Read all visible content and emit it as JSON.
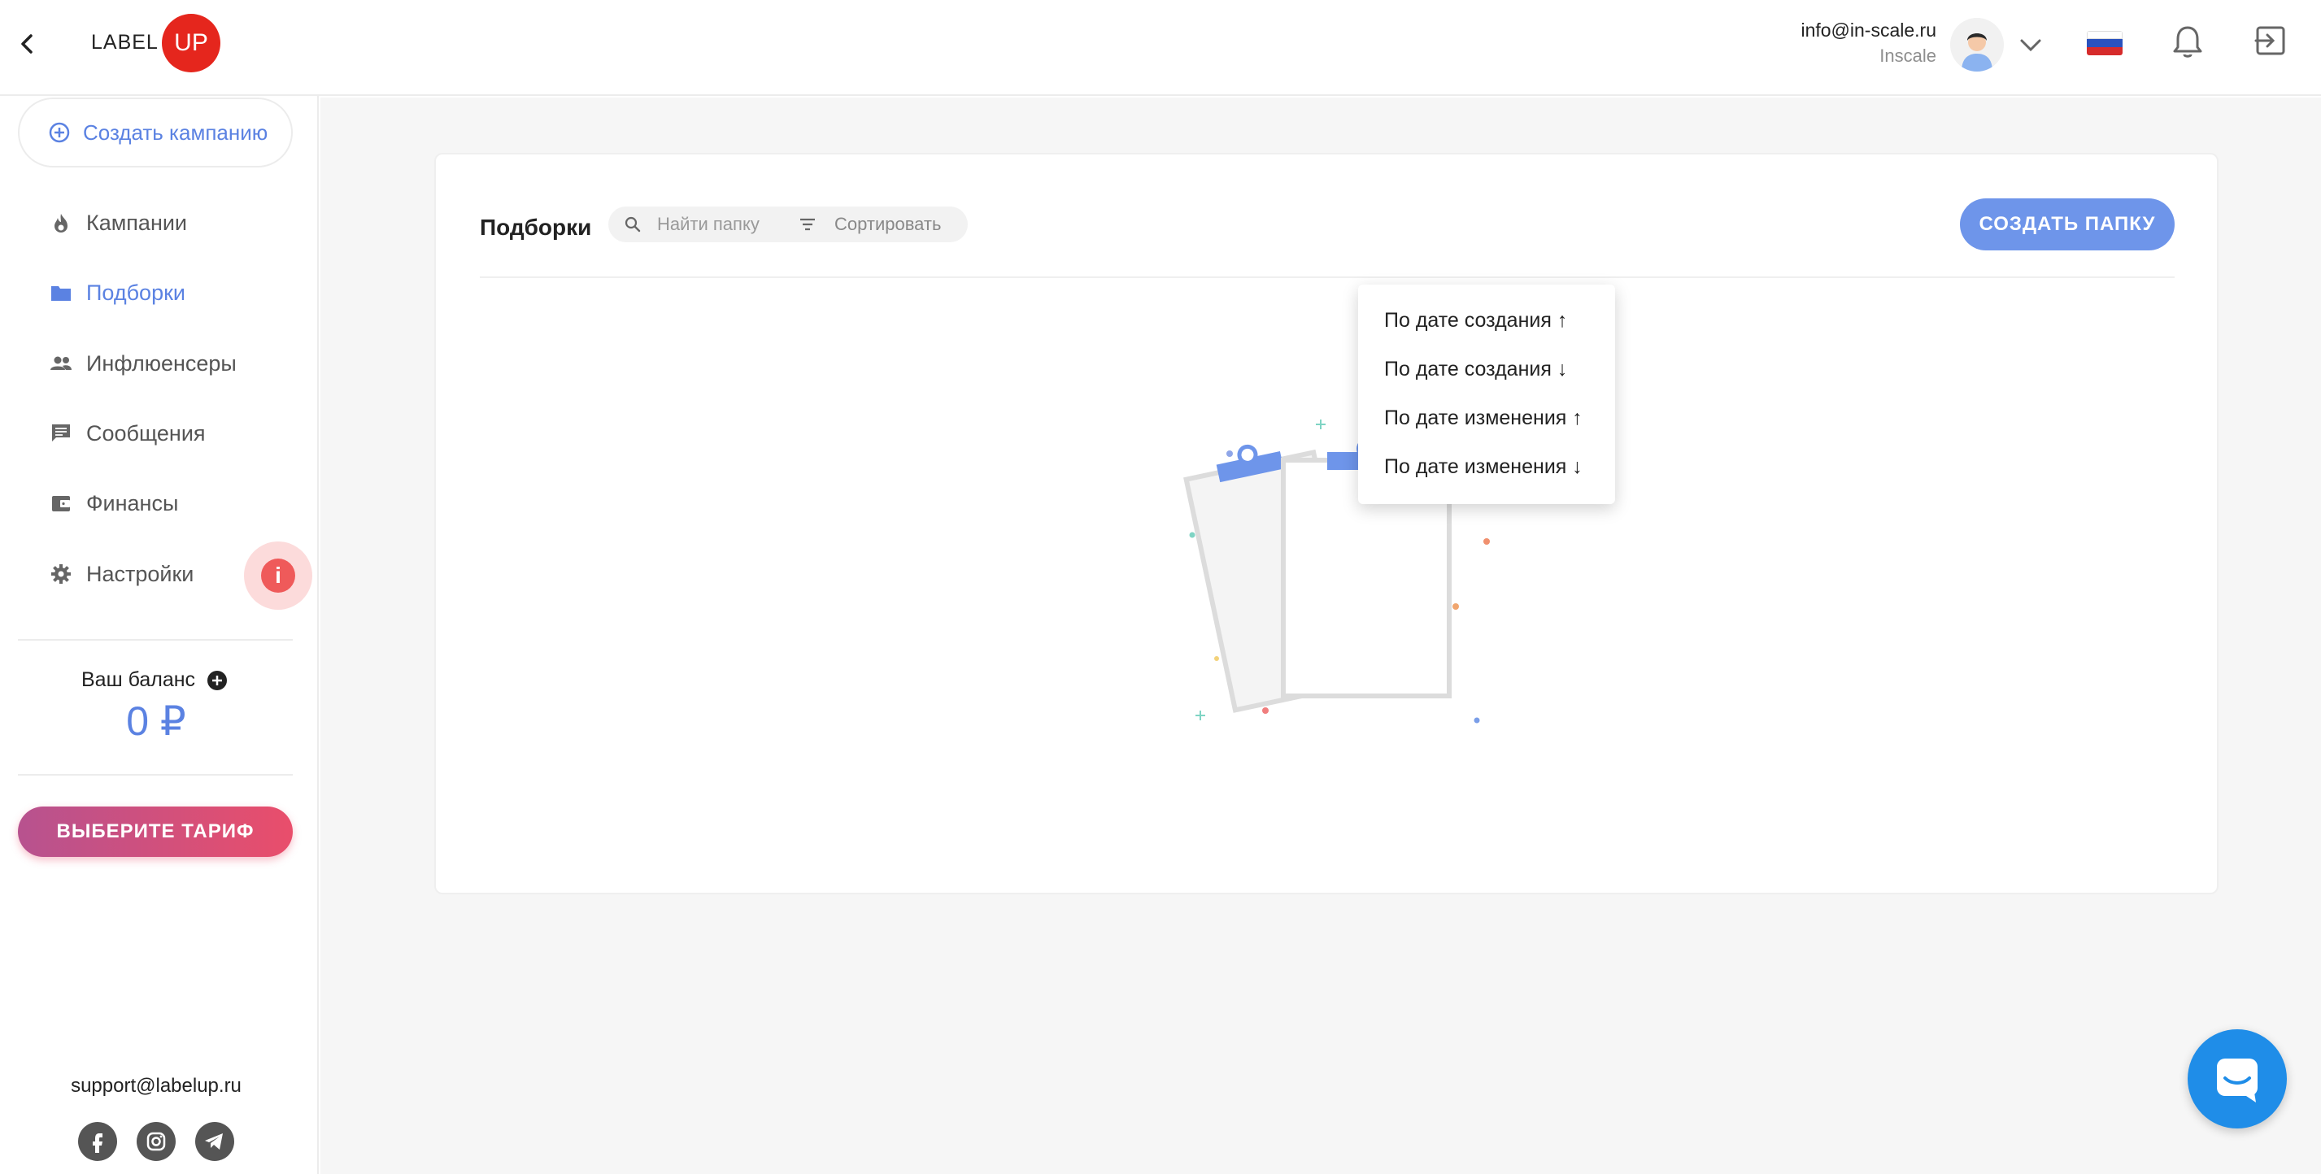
{
  "header": {
    "logo_label": "LABEL",
    "logo_badge": "UP",
    "user_email": "info@in-scale.ru",
    "user_company": "Inscale"
  },
  "sidebar": {
    "create_campaign": "Создать кампанию",
    "items": [
      {
        "label": "Кампании",
        "icon": "fire-icon"
      },
      {
        "label": "Подборки",
        "icon": "folder-icon",
        "active": true
      },
      {
        "label": "Инфлюенсеры",
        "icon": "people-icon"
      },
      {
        "label": "Сообщения",
        "icon": "message-icon"
      },
      {
        "label": "Финансы",
        "icon": "wallet-icon"
      },
      {
        "label": "Настройки",
        "icon": "gear-icon"
      }
    ],
    "balance_label": "Ваш баланс",
    "balance_value": "0 ₽",
    "tariff_button": "ВЫБЕРИТЕ ТАРИФ",
    "support_email": "support@labelup.ru"
  },
  "main": {
    "title": "Подборки",
    "search_placeholder": "Найти папку",
    "sort_label": "Сортировать",
    "create_folder": "СОЗДАТЬ ПАПКУ",
    "sort_options": [
      "По дате создания ↑",
      "По дате создания ↓",
      "По дате изменения ↑",
      "По дате изменения ↓"
    ]
  },
  "colors": {
    "accent": "#5b82e2",
    "brand_red": "#e5261d",
    "button_blue": "#6e95ea",
    "chat_blue": "#1f8de8"
  }
}
